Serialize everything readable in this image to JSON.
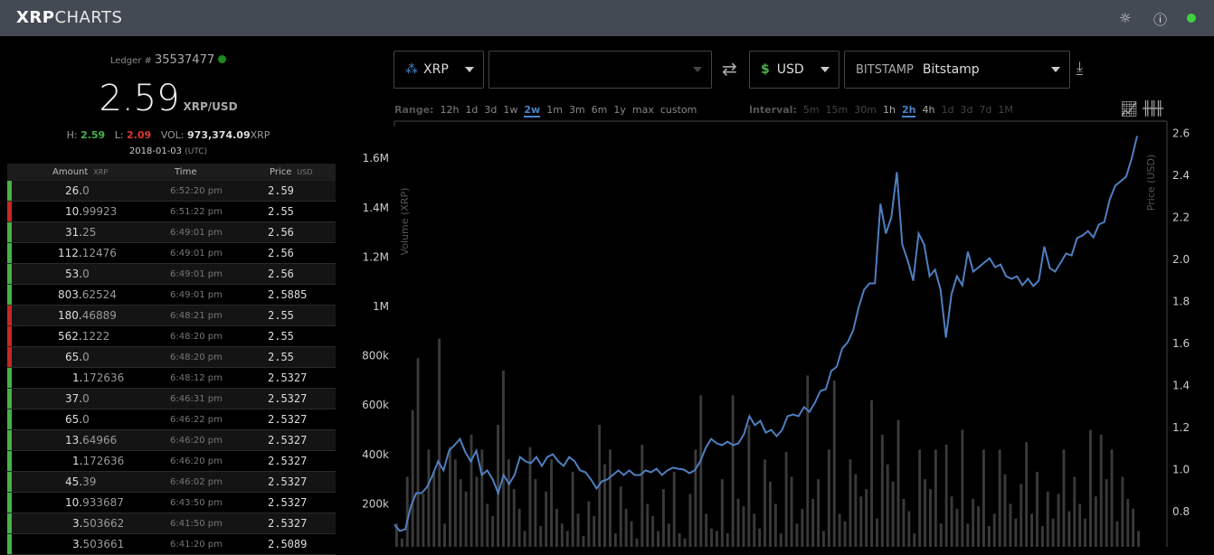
{
  "header": {
    "logo_bold": "XRP",
    "logo_light": "CHARTS",
    "theme_icon": "sun-icon",
    "info_icon": "info-icon",
    "status_color": "#3fd13f"
  },
  "summary": {
    "ledger_label": "Ledger #",
    "ledger": "35537477",
    "price": "2.59",
    "pair": "XRP/USD",
    "high_label": "H:",
    "high": "2.59",
    "low_label": "L:",
    "low": "2.09",
    "vol_label": "VOL:",
    "vol": "973,374.09",
    "vol_unit": "XRP",
    "date": "2018-01-03",
    "tz": "(UTC)"
  },
  "trades": {
    "headers": {
      "amount": "Amount",
      "amount_unit": "XRP",
      "time": "Time",
      "price": "Price",
      "price_unit": "USD"
    },
    "rows": [
      {
        "int": "26.",
        "dec": "0",
        "time": "6:52:20 pm",
        "price": "2.59",
        "side": "buy"
      },
      {
        "int": "10.",
        "dec": "99923",
        "time": "6:51:22 pm",
        "price": "2.55",
        "side": "sell"
      },
      {
        "int": "31.",
        "dec": "25",
        "time": "6:49:01 pm",
        "price": "2.56",
        "side": "buy"
      },
      {
        "int": "112.",
        "dec": "12476",
        "time": "6:49:01 pm",
        "price": "2.56",
        "side": "buy"
      },
      {
        "int": "53.",
        "dec": "0",
        "time": "6:49:01 pm",
        "price": "2.56",
        "side": "buy"
      },
      {
        "int": "803.",
        "dec": "62524",
        "time": "6:49:01 pm",
        "price": "2.5885",
        "side": "buy"
      },
      {
        "int": "180.",
        "dec": "46889",
        "time": "6:48:21 pm",
        "price": "2.55",
        "side": "sell"
      },
      {
        "int": "562.",
        "dec": "1222",
        "time": "6:48:20 pm",
        "price": "2.55",
        "side": "sell"
      },
      {
        "int": "65.",
        "dec": "0",
        "time": "6:48:20 pm",
        "price": "2.55",
        "side": "sell"
      },
      {
        "int": "1.",
        "dec": "172636",
        "time": "6:48:12 pm",
        "price": "2.5327",
        "side": "buy"
      },
      {
        "int": "37.",
        "dec": "0",
        "time": "6:46:31 pm",
        "price": "2.5327",
        "side": "buy"
      },
      {
        "int": "65.",
        "dec": "0",
        "time": "6:46:22 pm",
        "price": "2.5327",
        "side": "buy"
      },
      {
        "int": "13.",
        "dec": "64966",
        "time": "6:46:20 pm",
        "price": "2.5327",
        "side": "buy"
      },
      {
        "int": "1.",
        "dec": "172636",
        "time": "6:46:20 pm",
        "price": "2.5327",
        "side": "buy"
      },
      {
        "int": "45.",
        "dec": "39",
        "time": "6:46:02 pm",
        "price": "2.5327",
        "side": "buy"
      },
      {
        "int": "10.",
        "dec": "933687",
        "time": "6:43:50 pm",
        "price": "2.5327",
        "side": "buy"
      },
      {
        "int": "3.",
        "dec": "503662",
        "time": "6:41:50 pm",
        "price": "2.5327",
        "side": "buy"
      },
      {
        "int": "3.",
        "dec": "503661",
        "time": "6:41:20 pm",
        "price": "2.5089",
        "side": "buy"
      }
    ],
    "colors": {
      "buy": "#46b04a",
      "sell": "#c62828"
    }
  },
  "controls": {
    "base": "XRP",
    "base_issuer": "",
    "counter": "USD",
    "counter_symbol": "$",
    "exchange_tag": "BITSTAMP",
    "exchange": "Bitstamp",
    "range_label": "Range:",
    "ranges": [
      "12h",
      "1d",
      "3d",
      "1w",
      "2w",
      "1m",
      "3m",
      "6m",
      "1y",
      "max",
      "custom"
    ],
    "range_selected": "2w",
    "interval_label": "Interval:",
    "intervals": [
      "5m",
      "15m",
      "30m",
      "1h",
      "2h",
      "4h",
      "1d",
      "3d",
      "7d",
      "1M"
    ],
    "intervals_enabled": [
      "1h",
      "2h",
      "4h"
    ],
    "interval_selected": "2h"
  },
  "chart_data": {
    "type": "line",
    "left_axis_label": "Volume (XRP)",
    "right_axis_label": "Price (USD)",
    "volume_ticks": [
      "200k",
      "400k",
      "600k",
      "800k",
      "1M",
      "1.2M",
      "1.4M",
      "1.6M"
    ],
    "price_ticks": [
      "0.8",
      "1.0",
      "1.2",
      "1.4",
      "1.6",
      "1.8",
      "2.0",
      "2.2",
      "2.4",
      "2.6"
    ],
    "price_range": [
      0.68,
      2.72
    ],
    "volume_range": [
      0,
      1800000
    ],
    "line_color": "#4f7fc0",
    "price": [
      0.738,
      0.708,
      0.716,
      0.824,
      0.888,
      0.888,
      0.918,
      0.974,
      1.039,
      0.996,
      1.09,
      1.116,
      1.146,
      1.082,
      1.039,
      1.09,
      0.974,
      0.996,
      0.953,
      0.888,
      0.974,
      0.931,
      0.974,
      1.06,
      1.039,
      1.03,
      1.06,
      1.017,
      1.06,
      1.073,
      1.039,
      1.017,
      1.06,
      1.039,
      0.996,
      0.987,
      0.953,
      0.91,
      0.944,
      0.953,
      0.974,
      0.996,
      0.974,
      0.996,
      0.974,
      0.974,
      0.996,
      0.987,
      1.004,
      0.974,
      0.996,
      1.009,
      1.004,
      1.0,
      0.983,
      0.996,
      1.039,
      1.103,
      1.146,
      1.125,
      1.116,
      1.133,
      1.116,
      1.125,
      1.168,
      1.254,
      1.211,
      1.232,
      1.176,
      1.189,
      1.159,
      1.189,
      1.254,
      1.262,
      1.254,
      1.297,
      1.275,
      1.318,
      1.374,
      1.383,
      1.469,
      1.49,
      1.576,
      1.606,
      1.662,
      1.77,
      1.856,
      1.886,
      1.886,
      2.265,
      2.123,
      2.2,
      2.415,
      2.071,
      1.994,
      1.899,
      2.123,
      2.071,
      1.92,
      1.951,
      1.856,
      1.628,
      1.834,
      1.92,
      1.877,
      2.037,
      1.942,
      1.963,
      1.985,
      2.006,
      1.963,
      1.976,
      1.92,
      1.908,
      1.92,
      1.877,
      1.908,
      1.873,
      1.899,
      2.062,
      1.959,
      1.942,
      1.985,
      2.028,
      2.019,
      2.101,
      2.114,
      2.135,
      2.105,
      2.166,
      2.178,
      2.286,
      2.351,
      2.372,
      2.394,
      2.48,
      2.587
    ],
    "volume": [
      120,
      60,
      310,
      580,
      790,
      240,
      420,
      330,
      870,
      120,
      430,
      380,
      300,
      250,
      480,
      310,
      420,
      200,
      150,
      520,
      740,
      380,
      260,
      180,
      90,
      430,
      300,
      110,
      250,
      380,
      180,
      120,
      90,
      330,
      160,
      70,
      210,
      150,
      520,
      360,
      420,
      80,
      270,
      180,
      130,
      60,
      440,
      200,
      150,
      90,
      260,
      120,
      330,
      80,
      60,
      240,
      420,
      640,
      160,
      100,
      90,
      300,
      80,
      640,
      220,
      190,
      520,
      160,
      100,
      380,
      290,
      200,
      80,
      410,
      310,
      120,
      180,
      720,
      220,
      300,
      90,
      420,
      700,
      160,
      130,
      380,
      320,
      230,
      260,
      620,
      140,
      480,
      360,
      290,
      540,
      220,
      170,
      80,
      420,
      300,
      260,
      420,
      120,
      440,
      230,
      180,
      500,
      120,
      220,
      190,
      420,
      110,
      160,
      420,
      320,
      200,
      140,
      280,
      450,
      160,
      330,
      110,
      250,
      140,
      240,
      420,
      170,
      310,
      200,
      140,
      500,
      230,
      480,
      300,
      420,
      130,
      310,
      220,
      180,
      90
    ]
  }
}
